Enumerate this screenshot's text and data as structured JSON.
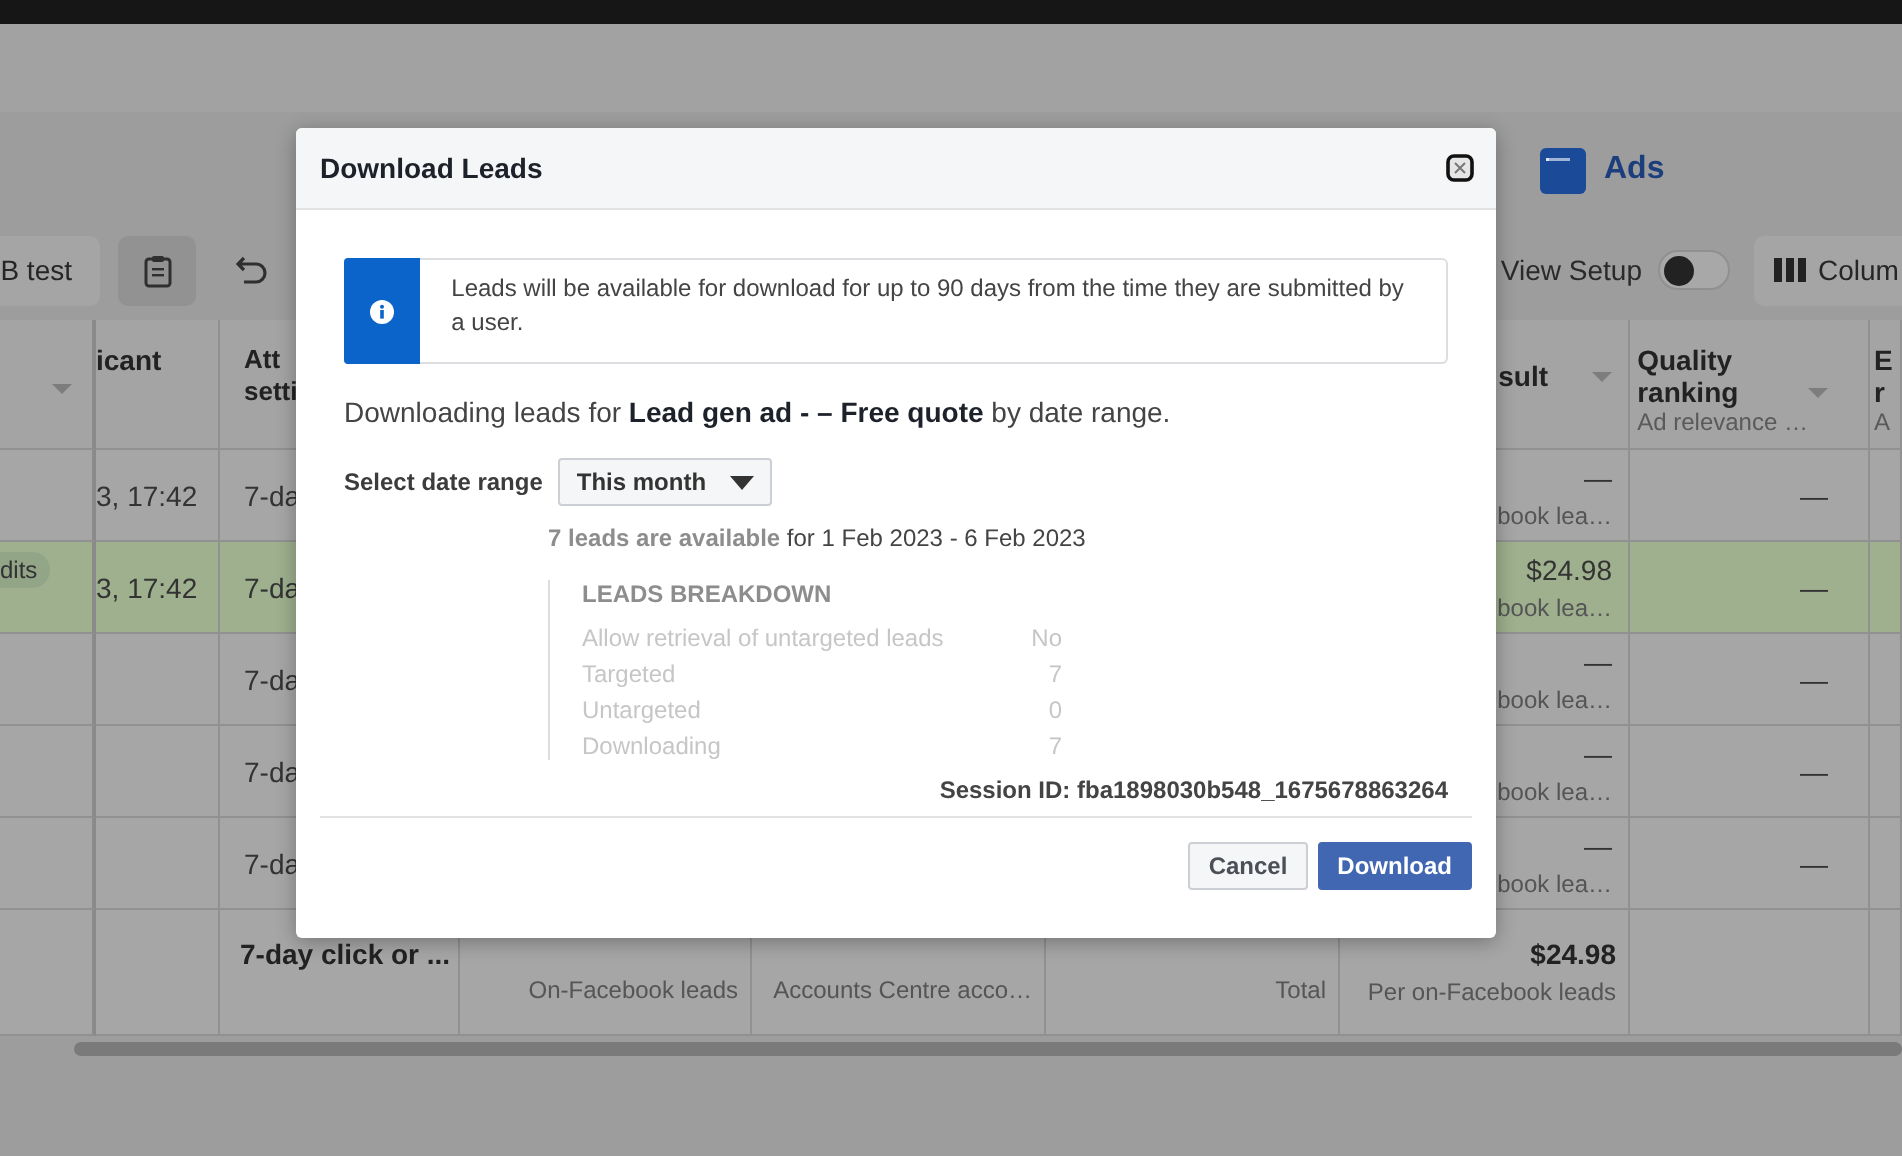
{
  "app_header": {
    "title": "Ads"
  },
  "toolbar": {
    "test_button": {
      "label": "B test"
    },
    "view_setup": {
      "label": "View Setup",
      "on": false
    },
    "columns_button": {
      "label": "Colum"
    }
  },
  "table": {
    "columns": [
      {
        "sortable": true
      },
      {
        "lines": [
          "icant"
        ],
        "sortable": false
      },
      {
        "lines": [
          "Att",
          "setti"
        ],
        "sortable": false
      },
      {
        "lines": [
          "sult"
        ],
        "sortable": true
      },
      {
        "lines": [
          "Quality",
          "ranking"
        ],
        "sub": "Ad relevance …",
        "sortable": true
      },
      {
        "lines": [
          "E",
          "r"
        ],
        "sub": "A",
        "sortable": false
      }
    ],
    "rows": [
      {
        "selected": false,
        "time": "3, 17:42",
        "attribution": "7-da",
        "result": "—",
        "result_note": "book lea…",
        "quality": "—"
      },
      {
        "selected": true,
        "badge": "dits",
        "time": "3, 17:42",
        "attribution": "7-da",
        "result": "$24.98",
        "result_note": "book lea…",
        "quality": "—"
      },
      {
        "selected": false,
        "attribution": "7-da",
        "result": "—",
        "result_note": "book lea…",
        "quality": "—"
      },
      {
        "selected": false,
        "attribution": "7-da",
        "result": "—",
        "result_note": "book lea…",
        "quality": "—"
      },
      {
        "selected": false,
        "attribution": "7-da",
        "result": "—",
        "result_note": "book lea…",
        "quality": "—"
      }
    ],
    "totals": {
      "attribution": "7-day click or ...",
      "result": "$24.98",
      "notes": [
        "On-Facebook leads",
        "Accounts Centre acco…",
        "Total",
        "Per on-Facebook leads"
      ]
    }
  },
  "dialog": {
    "title": "Download Leads",
    "notice": "Leads will be available for download for up to 90 days from the time they are submitted by a user.",
    "intro": "Downloading leads for **Lead gen ad - – Free quote** by date range.",
    "date_range": {
      "label": "Select date range",
      "value": "This month"
    },
    "availability": "**7 leads are available** for 1 Feb 2023 - 6 Feb 2023",
    "breakdown": {
      "title": "LEADS BREAKDOWN",
      "rows": [
        {
          "label": "Allow retrieval of untargeted leads",
          "value": "No"
        },
        {
          "label": "Targeted",
          "value": "7"
        },
        {
          "label": "Untargeted",
          "value": "0"
        },
        {
          "label": "Downloading",
          "value": "7"
        }
      ]
    },
    "session": "Session ID: fba1898030b548_1675678863264",
    "buttons": [
      {
        "label": "Cancel",
        "kind": "secondary"
      },
      {
        "label": "Download",
        "kind": "primary"
      }
    ]
  }
}
